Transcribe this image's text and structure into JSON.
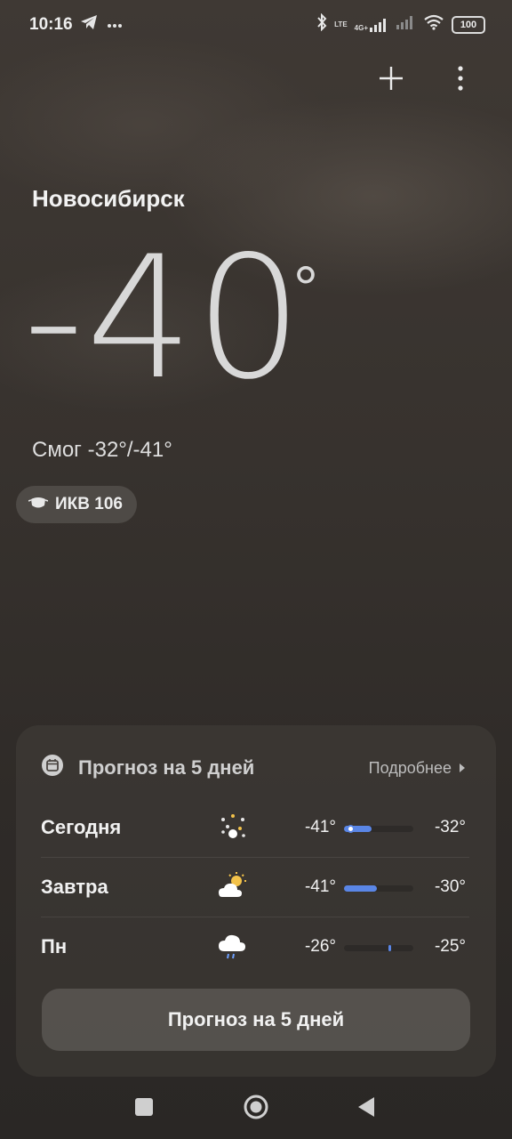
{
  "status_bar": {
    "time": "10:16",
    "left_icons": [
      "telegram-icon",
      "more-dots-icon"
    ],
    "right_icons": [
      "bluetooth-icon",
      "volte-icon",
      "signal-4g-icon",
      "signal-icon",
      "wifi-icon",
      "battery-icon"
    ],
    "network_label": "4G+",
    "volte_label": "LTE",
    "battery": "100"
  },
  "header": {
    "add_icon": "plus-icon",
    "menu_icon": "more-vertical-icon"
  },
  "weather": {
    "city": "Новосибирск",
    "temperature": "-40",
    "unit": "°",
    "condition": "Смог  -32°/-41°",
    "aqi_label": "ИКВ 106",
    "aqi_icon": "mask-icon"
  },
  "forecast": {
    "title": "Прогноз на 5 дней",
    "details_label": "Подробнее",
    "days": [
      {
        "day": "Сегодня",
        "icon": "fog-dots-icon",
        "min": "-41°",
        "max": "-32°",
        "range_start": 0.0,
        "range_end": 0.4
      },
      {
        "day": "Завтра",
        "icon": "partly-cloudy-sun-icon",
        "min": "-41°",
        "max": "-30°",
        "range_start": 0.0,
        "range_end": 0.48
      },
      {
        "day": "Пн",
        "icon": "cloud-rain-icon",
        "min": "-26°",
        "max": "-25°",
        "range_start": 0.64,
        "range_end": 0.68
      }
    ],
    "button_label": "Прогноз на 5 дней"
  },
  "colors": {
    "accent_bar": "#5a86e6"
  },
  "nav": {
    "items": [
      "recents-square-icon",
      "home-circle-icon",
      "back-triangle-icon"
    ]
  }
}
